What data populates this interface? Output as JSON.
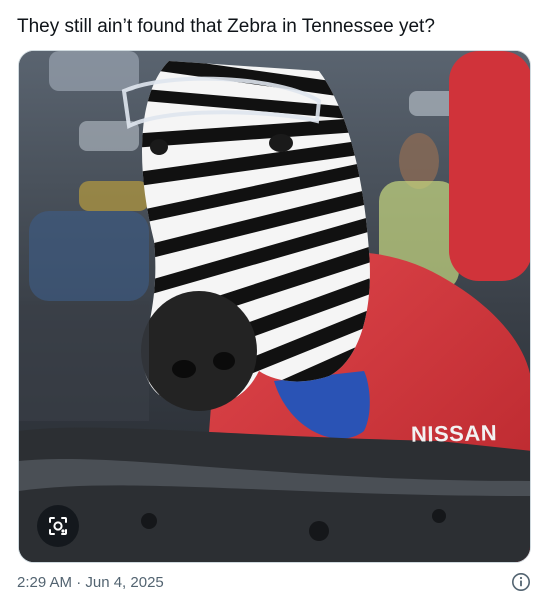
{
  "tweet": {
    "text": "They still ain’t found that Zebra in Tennessee yet?",
    "timestamp": "2:29 AM · Jun 4, 2025"
  },
  "media": {
    "alt": "AI image of a zebra wearing safety glasses and a red Nissan shirt in a factory",
    "shirt_logo": "NISSAN",
    "lens_icon": "visual-search-icon"
  },
  "icons": {
    "info": "info-icon"
  },
  "colors": {
    "text": "#0f1419",
    "secondary": "#536471",
    "shirt_red": "#d3373d",
    "border": "#cfd9de"
  }
}
